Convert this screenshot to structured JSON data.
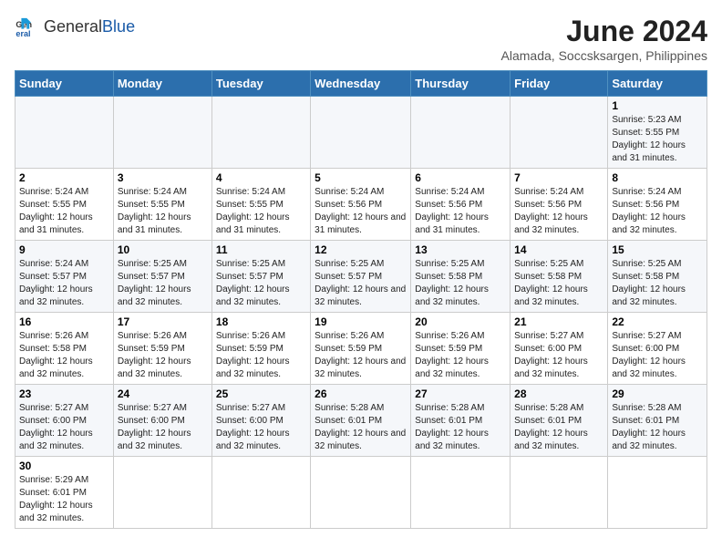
{
  "header": {
    "logo_general": "General",
    "logo_blue": "Blue",
    "month_title": "June 2024",
    "subtitle": "Alamada, Soccsksargen, Philippines"
  },
  "days_of_week": [
    "Sunday",
    "Monday",
    "Tuesday",
    "Wednesday",
    "Thursday",
    "Friday",
    "Saturday"
  ],
  "weeks": [
    [
      {
        "day": "",
        "info": ""
      },
      {
        "day": "",
        "info": ""
      },
      {
        "day": "",
        "info": ""
      },
      {
        "day": "",
        "info": ""
      },
      {
        "day": "",
        "info": ""
      },
      {
        "day": "",
        "info": ""
      },
      {
        "day": "1",
        "info": "Sunrise: 5:23 AM\nSunset: 5:55 PM\nDaylight: 12 hours and 31 minutes."
      }
    ],
    [
      {
        "day": "2",
        "info": "Sunrise: 5:24 AM\nSunset: 5:55 PM\nDaylight: 12 hours and 31 minutes."
      },
      {
        "day": "3",
        "info": "Sunrise: 5:24 AM\nSunset: 5:55 PM\nDaylight: 12 hours and 31 minutes."
      },
      {
        "day": "4",
        "info": "Sunrise: 5:24 AM\nSunset: 5:55 PM\nDaylight: 12 hours and 31 minutes."
      },
      {
        "day": "5",
        "info": "Sunrise: 5:24 AM\nSunset: 5:56 PM\nDaylight: 12 hours and 31 minutes."
      },
      {
        "day": "6",
        "info": "Sunrise: 5:24 AM\nSunset: 5:56 PM\nDaylight: 12 hours and 31 minutes."
      },
      {
        "day": "7",
        "info": "Sunrise: 5:24 AM\nSunset: 5:56 PM\nDaylight: 12 hours and 32 minutes."
      },
      {
        "day": "8",
        "info": "Sunrise: 5:24 AM\nSunset: 5:56 PM\nDaylight: 12 hours and 32 minutes."
      }
    ],
    [
      {
        "day": "9",
        "info": "Sunrise: 5:24 AM\nSunset: 5:57 PM\nDaylight: 12 hours and 32 minutes."
      },
      {
        "day": "10",
        "info": "Sunrise: 5:25 AM\nSunset: 5:57 PM\nDaylight: 12 hours and 32 minutes."
      },
      {
        "day": "11",
        "info": "Sunrise: 5:25 AM\nSunset: 5:57 PM\nDaylight: 12 hours and 32 minutes."
      },
      {
        "day": "12",
        "info": "Sunrise: 5:25 AM\nSunset: 5:57 PM\nDaylight: 12 hours and 32 minutes."
      },
      {
        "day": "13",
        "info": "Sunrise: 5:25 AM\nSunset: 5:58 PM\nDaylight: 12 hours and 32 minutes."
      },
      {
        "day": "14",
        "info": "Sunrise: 5:25 AM\nSunset: 5:58 PM\nDaylight: 12 hours and 32 minutes."
      },
      {
        "day": "15",
        "info": "Sunrise: 5:25 AM\nSunset: 5:58 PM\nDaylight: 12 hours and 32 minutes."
      }
    ],
    [
      {
        "day": "16",
        "info": "Sunrise: 5:26 AM\nSunset: 5:58 PM\nDaylight: 12 hours and 32 minutes."
      },
      {
        "day": "17",
        "info": "Sunrise: 5:26 AM\nSunset: 5:59 PM\nDaylight: 12 hours and 32 minutes."
      },
      {
        "day": "18",
        "info": "Sunrise: 5:26 AM\nSunset: 5:59 PM\nDaylight: 12 hours and 32 minutes."
      },
      {
        "day": "19",
        "info": "Sunrise: 5:26 AM\nSunset: 5:59 PM\nDaylight: 12 hours and 32 minutes."
      },
      {
        "day": "20",
        "info": "Sunrise: 5:26 AM\nSunset: 5:59 PM\nDaylight: 12 hours and 32 minutes."
      },
      {
        "day": "21",
        "info": "Sunrise: 5:27 AM\nSunset: 6:00 PM\nDaylight: 12 hours and 32 minutes."
      },
      {
        "day": "22",
        "info": "Sunrise: 5:27 AM\nSunset: 6:00 PM\nDaylight: 12 hours and 32 minutes."
      }
    ],
    [
      {
        "day": "23",
        "info": "Sunrise: 5:27 AM\nSunset: 6:00 PM\nDaylight: 12 hours and 32 minutes."
      },
      {
        "day": "24",
        "info": "Sunrise: 5:27 AM\nSunset: 6:00 PM\nDaylight: 12 hours and 32 minutes."
      },
      {
        "day": "25",
        "info": "Sunrise: 5:27 AM\nSunset: 6:00 PM\nDaylight: 12 hours and 32 minutes."
      },
      {
        "day": "26",
        "info": "Sunrise: 5:28 AM\nSunset: 6:01 PM\nDaylight: 12 hours and 32 minutes."
      },
      {
        "day": "27",
        "info": "Sunrise: 5:28 AM\nSunset: 6:01 PM\nDaylight: 12 hours and 32 minutes."
      },
      {
        "day": "28",
        "info": "Sunrise: 5:28 AM\nSunset: 6:01 PM\nDaylight: 12 hours and 32 minutes."
      },
      {
        "day": "29",
        "info": "Sunrise: 5:28 AM\nSunset: 6:01 PM\nDaylight: 12 hours and 32 minutes."
      }
    ],
    [
      {
        "day": "30",
        "info": "Sunrise: 5:29 AM\nSunset: 6:01 PM\nDaylight: 12 hours and 32 minutes."
      },
      {
        "day": "",
        "info": ""
      },
      {
        "day": "",
        "info": ""
      },
      {
        "day": "",
        "info": ""
      },
      {
        "day": "",
        "info": ""
      },
      {
        "day": "",
        "info": ""
      },
      {
        "day": "",
        "info": ""
      }
    ]
  ]
}
